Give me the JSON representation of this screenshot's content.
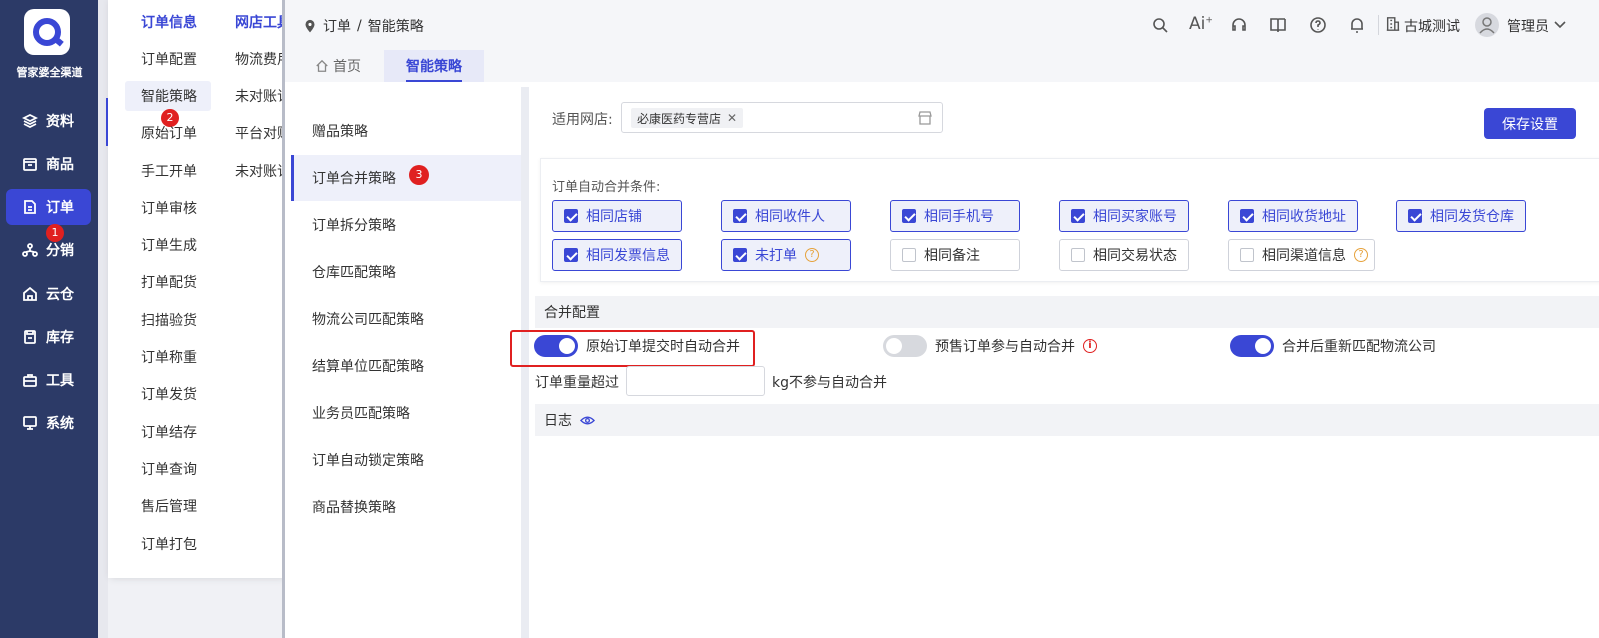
{
  "app": {
    "name": "管家婆全渠道"
  },
  "nav": [
    {
      "label": "资料",
      "icon": "layers-icon"
    },
    {
      "label": "商品",
      "icon": "box-icon"
    },
    {
      "label": "订单",
      "icon": "document-icon",
      "active": true,
      "badge": "1"
    },
    {
      "label": "分销",
      "icon": "network-icon"
    },
    {
      "label": "云仓",
      "icon": "warehouse-icon"
    },
    {
      "label": "库存",
      "icon": "inventory-icon"
    },
    {
      "label": "工具",
      "icon": "toolbox-icon"
    },
    {
      "label": "系统",
      "icon": "monitor-icon"
    }
  ],
  "menu": {
    "col1_header": "订单信息",
    "col2_header": "网店工具",
    "col1": [
      "订单配置",
      "智能策略",
      "原始订单",
      "手工开单",
      "订单审核",
      "订单生成",
      "打单配货",
      "扫描验货",
      "订单称重",
      "订单发货",
      "订单结存",
      "订单查询",
      "售后管理",
      "订单打包"
    ],
    "col2": [
      "物流费用",
      "未对账订",
      "平台对账",
      "未对账订"
    ],
    "active_badge": "2"
  },
  "topbar": {
    "breadcrumb": [
      "订单",
      "/",
      "智能策略"
    ],
    "org": "古城测试",
    "user": "管理员",
    "icons": [
      "search-icon",
      "ai-icon",
      "headset-icon",
      "book-icon",
      "help-icon",
      "bell-icon"
    ]
  },
  "tabs": [
    {
      "label": "首页",
      "icon": "home-icon"
    },
    {
      "label": "智能策略",
      "active": true
    }
  ],
  "strategies": {
    "items": [
      "赠品策略",
      "订单合并策略",
      "订单拆分策略",
      "仓库匹配策略",
      "物流公司匹配策略",
      "结算单位匹配策略",
      "业务员匹配策略",
      "订单自动锁定策略",
      "商品替换策略"
    ],
    "active_index": 1,
    "active_badge": "3"
  },
  "content": {
    "shop_label": "适用网店:",
    "shop_tag": "必康医药专营店",
    "save_button": "保存设置",
    "conditions_title": "订单自动合并条件:",
    "conditions": [
      {
        "label": "相同店铺",
        "checked": true
      },
      {
        "label": "相同收件人",
        "checked": true
      },
      {
        "label": "相同手机号",
        "checked": true
      },
      {
        "label": "相同买家账号",
        "checked": true
      },
      {
        "label": "相同收货地址",
        "checked": true
      },
      {
        "label": "相同发货仓库",
        "checked": true
      },
      {
        "label": "相同发票信息",
        "checked": true
      },
      {
        "label": "未打单",
        "checked": true,
        "help": true
      },
      {
        "label": "相同备注",
        "checked": false
      },
      {
        "label": "相同交易状态",
        "checked": false
      },
      {
        "label": "相同渠道信息",
        "checked": false,
        "help": true
      }
    ],
    "merge_section": "合并配置",
    "toggles": [
      {
        "label": "原始订单提交时自动合并",
        "on": true
      },
      {
        "label": "预售订单参与自动合并",
        "on": false,
        "info": true
      },
      {
        "label": "合并后重新匹配物流公司",
        "on": true
      }
    ],
    "weight_label": "订单重量超过",
    "weight_value": "",
    "weight_suffix": "kg不参与自动合并",
    "log_section": "日志"
  }
}
